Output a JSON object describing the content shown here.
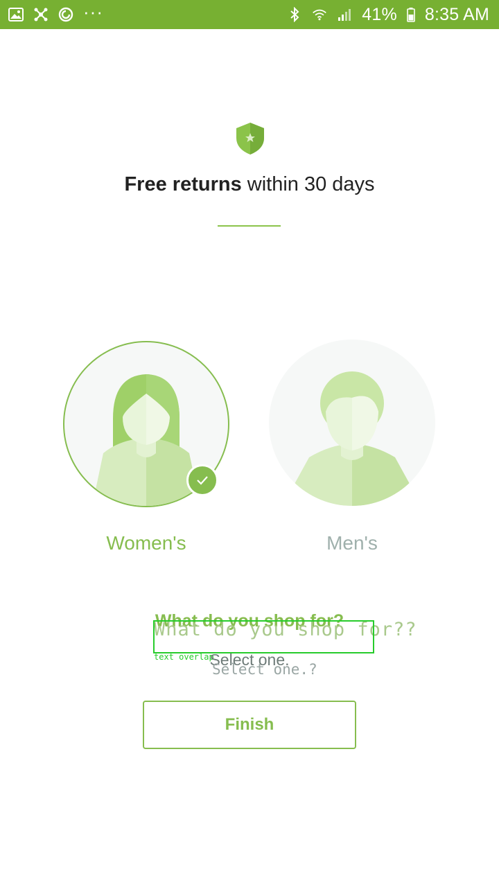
{
  "status_bar": {
    "battery": "41%",
    "time": "8:35 AM",
    "left_icons": [
      "gallery-icon",
      "connect-icon",
      "sync-icon",
      "more-dots-icon"
    ],
    "right_icons": [
      "bluetooth-icon",
      "wifi-icon",
      "signal-icon",
      "battery-icon"
    ]
  },
  "banner": {
    "headline_bold": "Free returns",
    "headline_rest": " within 30 days"
  },
  "options": [
    {
      "label": "Women's",
      "selected": true
    },
    {
      "label": "Men's",
      "selected": false
    }
  ],
  "prompt": {
    "question": "What do you shop for?",
    "question_overlay": "What do you shop for??",
    "overlay_tag": "text overlap",
    "subtitle": "Select one.",
    "subtitle_overlay": "Select one.?"
  },
  "finish_label": "Finish",
  "colors": {
    "accent": "#86bd4f",
    "status_bar": "#77b032",
    "inactive": "#9fb0ac"
  }
}
